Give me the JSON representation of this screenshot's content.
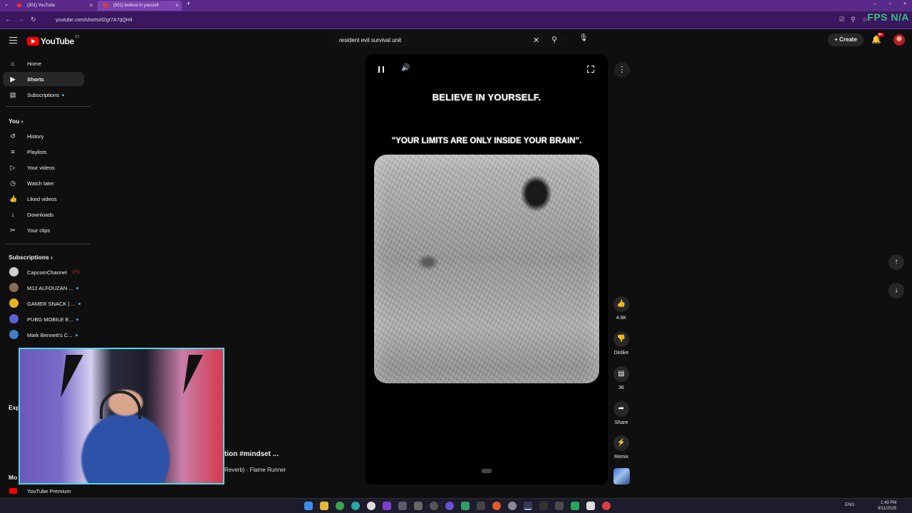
{
  "browser": {
    "tabs": [
      {
        "title": "(301) YouTube",
        "active": false
      },
      {
        "title": "(301) believe in yourself",
        "active": true
      }
    ],
    "url": "youtube.com/shorts/d2gr7A7qQH4",
    "overlay_text": "FPS  N/A"
  },
  "masthead": {
    "logo_text": "YouTube",
    "logo_country": "JO",
    "search_value": "resident evil survival unit",
    "create_label": "Create",
    "notif_count": "9+"
  },
  "sidebar": {
    "main": [
      {
        "label": "Home",
        "icon": "home-icon"
      },
      {
        "label": "Shorts",
        "icon": "shorts-icon",
        "active": true
      },
      {
        "label": "Subscriptions",
        "icon": "subscriptions-icon"
      }
    ],
    "you_header": "You",
    "you": [
      {
        "label": "History",
        "icon": "history-icon"
      },
      {
        "label": "Playlists",
        "icon": "playlists-icon"
      },
      {
        "label": "Your videos",
        "icon": "your-videos-icon"
      },
      {
        "label": "Watch later",
        "icon": "watch-later-icon"
      },
      {
        "label": "Liked videos",
        "icon": "liked-videos-icon"
      },
      {
        "label": "Downloads",
        "icon": "downloads-icon"
      },
      {
        "label": "Your clips",
        "icon": "clips-icon"
      }
    ],
    "subs_header": "Subscriptions",
    "subs": [
      {
        "label": "CapcomChannel",
        "color": "#cfcfcf"
      },
      {
        "label": "M12 ALFOUZAN ...",
        "color": "#8a6b55"
      },
      {
        "label": "GAMER SNACK | ...",
        "color": "#e6b422"
      },
      {
        "label": "PUBG MOBILE E...",
        "color": "#5a63d6"
      },
      {
        "label": "Mark Bennett's C...",
        "color": "#3d7fc9"
      }
    ],
    "explore_cut": "Exp",
    "more_cut": "Mo",
    "premium": "YouTube Premium"
  },
  "short": {
    "headline": "BELIEVE IN YOURSELF.",
    "quote": "\"YOUR LIMITS ARE ONLY INSIDE YOUR BRAIN\".",
    "title_partial": "tion #mindset ...",
    "sound_partial": "Reverb) · Flame Runner"
  },
  "actions": {
    "likes": "4.8K",
    "dislike": "Dislike",
    "comments": "36",
    "share": "Share",
    "remix": "Remix"
  },
  "taskbar": {
    "lang": "ENG",
    "time": "1:49 PM",
    "date": "9/11/2025"
  }
}
